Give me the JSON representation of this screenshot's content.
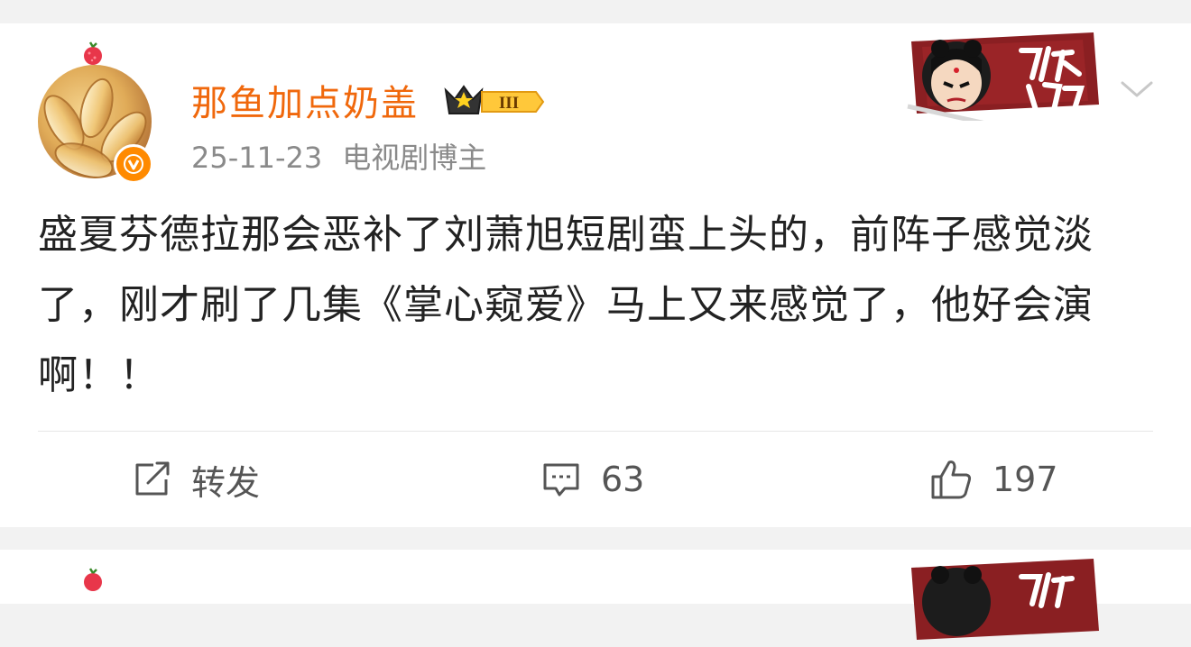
{
  "post": {
    "username": "那鱼加点奶盖",
    "member_level": "III",
    "date": "25-11-23",
    "tag": "电视剧博主",
    "content": "盛夏芬德拉那会恶补了刘萧旭短剧蛮上头的，前阵子感觉淡了，刚才刷了几集《掌心窥爱》马上又来感觉了，他好会演啊！！",
    "actions": {
      "repost_label": "转发",
      "comment_count": "63",
      "like_count": "197"
    },
    "icons": {
      "repost": "repost-icon",
      "comment": "comment-icon",
      "like": "thumbs-up-icon",
      "menu": "chevron-down-icon",
      "verified": "verified-v-icon",
      "crown": "crown-icon"
    }
  },
  "colors": {
    "username": "#f0680c",
    "verified_badge": "#ff8a00",
    "background": "#f2f2f2",
    "card": "#ffffff"
  }
}
